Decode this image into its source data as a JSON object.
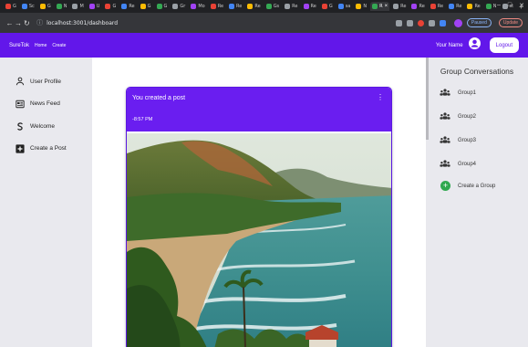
{
  "browser": {
    "tabs": [
      {
        "label": "G"
      },
      {
        "label": "Sc"
      },
      {
        "label": "G"
      },
      {
        "label": "N"
      },
      {
        "label": "M"
      },
      {
        "label": "U"
      },
      {
        "label": "G"
      },
      {
        "label": "Re"
      },
      {
        "label": "G"
      },
      {
        "label": "G"
      },
      {
        "label": "Gr"
      },
      {
        "label": "Mo"
      },
      {
        "label": "Re"
      },
      {
        "label": "Re"
      },
      {
        "label": "Re"
      },
      {
        "label": "Gs"
      },
      {
        "label": "Re"
      },
      {
        "label": "Re"
      },
      {
        "label": "G"
      },
      {
        "label": "sa"
      },
      {
        "label": "N"
      },
      {
        "label": "R"
      },
      {
        "label": "Re"
      },
      {
        "label": "Re"
      },
      {
        "label": "Re"
      },
      {
        "label": "Re"
      },
      {
        "label": "Re"
      },
      {
        "label": "N"
      },
      {
        "label": "st"
      }
    ],
    "url": "localhost:3001/dashboard",
    "paused_label": "Paused",
    "update_label": "Update"
  },
  "header": {
    "brand": "SureTok",
    "nav": [
      "Home",
      "Create"
    ],
    "user_name": "Your Name",
    "logout_label": "Logout"
  },
  "sidebar": {
    "items": [
      {
        "label": "User Profile",
        "icon": "person-icon"
      },
      {
        "label": "News Feed",
        "icon": "newspaper-icon"
      },
      {
        "label": "Welcome",
        "icon": "swirl-icon"
      },
      {
        "label": "Create a Post",
        "icon": "plus-square-icon"
      }
    ]
  },
  "post": {
    "title": "You created a post",
    "time": "-8:57 PM",
    "menu_icon": "more-vertical-icon"
  },
  "groups": {
    "title": "Group Conversations",
    "items": [
      {
        "label": "Group1",
        "icon": "people-icon"
      },
      {
        "label": "Group2",
        "icon": "people-icon"
      },
      {
        "label": "Group3",
        "icon": "people-icon"
      },
      {
        "label": "Group4",
        "icon": "people-icon"
      }
    ],
    "create_label": "Create a Group"
  },
  "colors": {
    "accent": "#6217ea",
    "sidebar_bg": "#e9e9ee",
    "create_green": "#2fa84f"
  }
}
